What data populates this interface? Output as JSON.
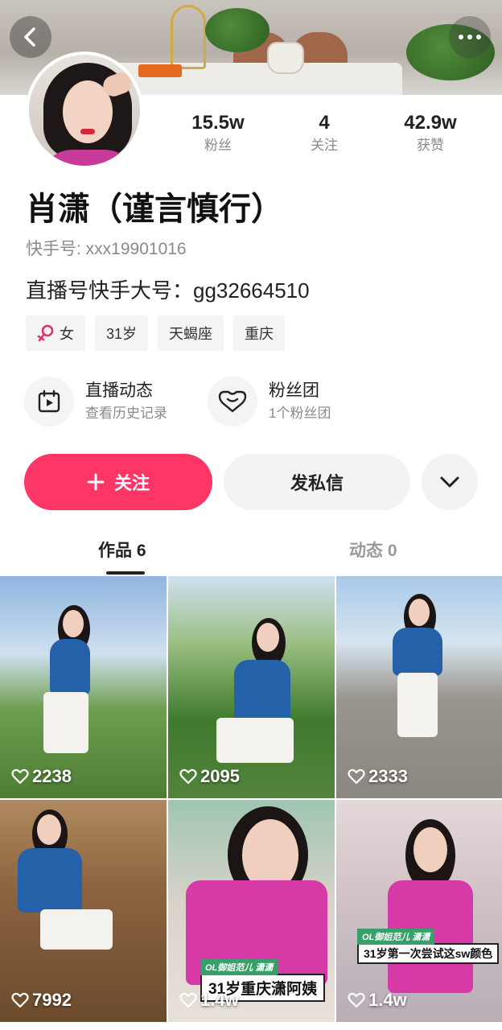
{
  "profile": {
    "followers": "15.5w",
    "followers_label": "粉丝",
    "following": "4",
    "following_label": "关注",
    "likes": "42.9w",
    "likes_label": "获赞",
    "name": "肖潇（谨言慎行）",
    "kuaishou_id": "快手号: xxx19901016",
    "bio": "直播号快手大号：gg32664510",
    "tags": [
      "女",
      "31岁",
      "天蝎座",
      "重庆"
    ]
  },
  "features": {
    "live": {
      "title": "直播动态",
      "subtitle": "查看历史记录",
      "icon": "calendar-play-icon"
    },
    "fans": {
      "title": "粉丝团",
      "subtitle": "1个粉丝团",
      "icon": "heart-badge-icon"
    }
  },
  "actions": {
    "follow": "关注",
    "message": "发私信",
    "more_icon": "chevron-down-icon"
  },
  "tabs": {
    "works": "作品 6",
    "moments": "动态 0"
  },
  "works": [
    {
      "likes": "2238"
    },
    {
      "likes": "2095"
    },
    {
      "likes": "2333"
    },
    {
      "likes": "7992"
    },
    {
      "likes": "1.4w",
      "caption_small": "OL御姐范儿 潇潇",
      "caption": "31岁重庆潇阿姨"
    },
    {
      "likes": "1.4w",
      "caption_small": "OL御姐范儿 潇潇",
      "caption": "31岁第一次尝试这sw颜色"
    }
  ],
  "colors": {
    "accent": "#fe3666",
    "female": "#e0336a"
  }
}
